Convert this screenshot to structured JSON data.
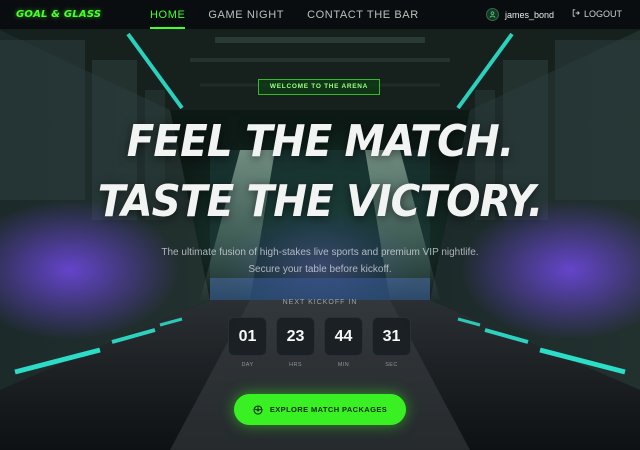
{
  "header": {
    "logo": "GOAL & GLASS",
    "nav": [
      {
        "label": "HOME",
        "active": true
      },
      {
        "label": "GAME NIGHT",
        "active": false
      },
      {
        "label": "CONTACT THE BAR",
        "active": false
      }
    ],
    "username": "james_bond",
    "logout_label": "LOGOUT"
  },
  "hero": {
    "badge": "WELCOME TO THE ARENA",
    "headline_1": "FEEL THE MATCH.",
    "headline_2": "TASTE THE VICTORY.",
    "subtitle": "The ultimate fusion of high-stakes live sports and premium VIP nightlife. Secure your table before kickoff.",
    "countdown_label": "NEXT KICKOFF IN",
    "countdown": [
      {
        "value": "01",
        "unit": "DAY"
      },
      {
        "value": "23",
        "unit": "HRS"
      },
      {
        "value": "44",
        "unit": "MIN"
      },
      {
        "value": "31",
        "unit": "SEC"
      }
    ],
    "cta_label": "EXPLORE MATCH PACKAGES"
  },
  "colors": {
    "accent": "#39f022",
    "neon_cyan": "#2ef0d8",
    "neon_purple": "#7b5cff",
    "header_bg": "#0a0d10"
  },
  "icons": {
    "user": "user-circle-icon",
    "logout": "logout-arrow-icon",
    "cta": "soccer-ball-icon"
  }
}
